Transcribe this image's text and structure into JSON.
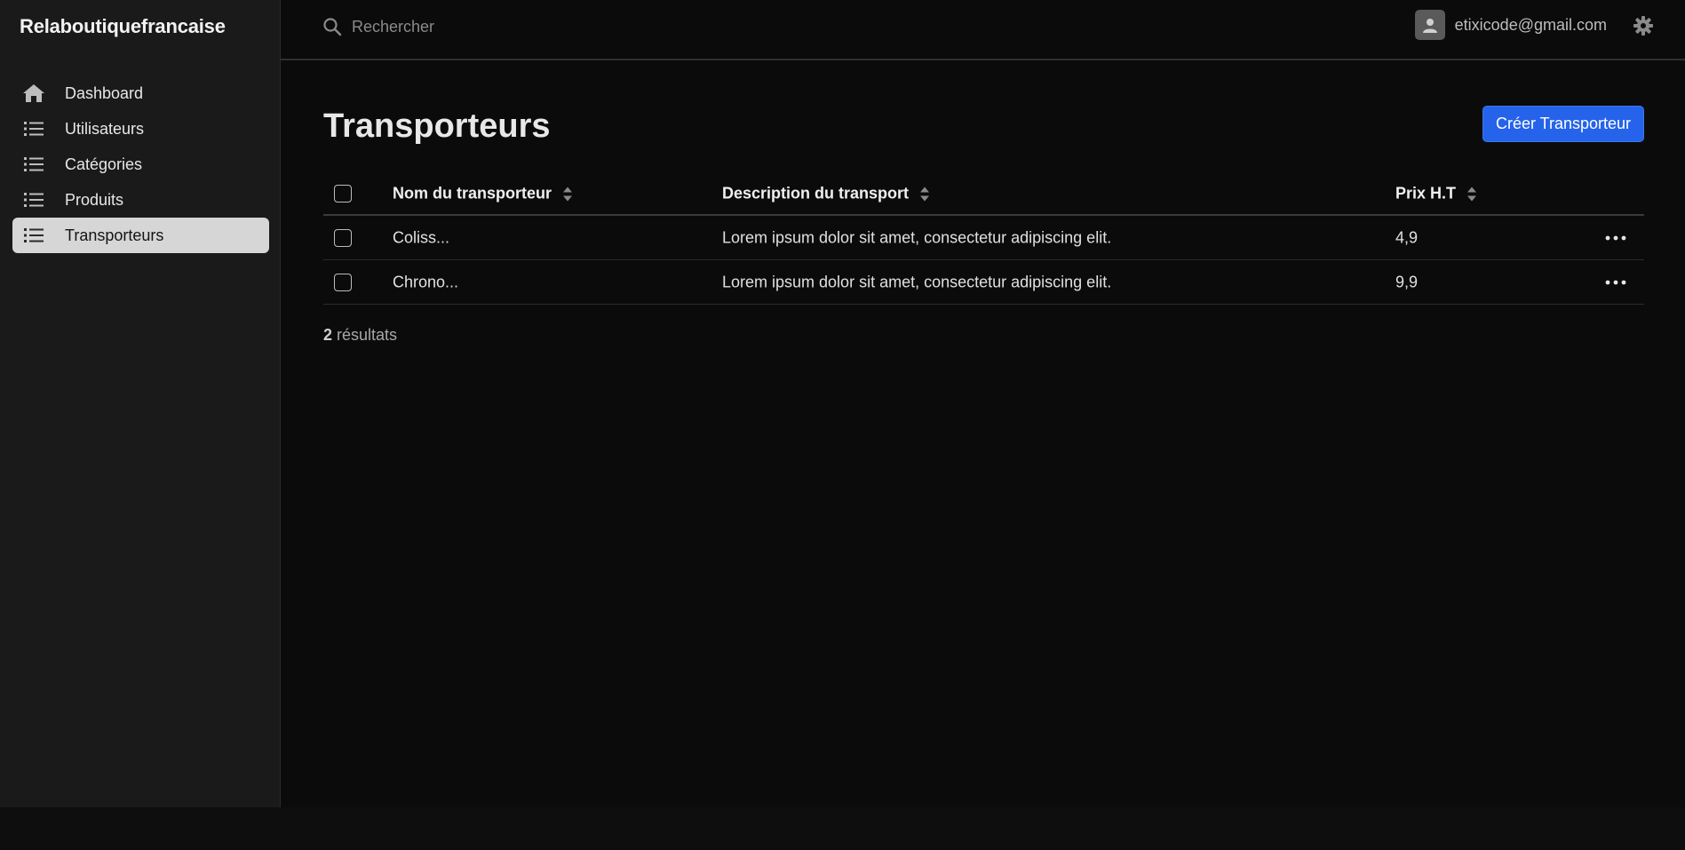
{
  "app": {
    "brand": "Relaboutiquefrancaise"
  },
  "sidebar": {
    "items": [
      {
        "label": "Dashboard",
        "icon": "home-icon",
        "active": false
      },
      {
        "label": "Utilisateurs",
        "icon": "list-icon",
        "active": false
      },
      {
        "label": "Catégories",
        "icon": "list-icon",
        "active": false
      },
      {
        "label": "Produits",
        "icon": "list-icon",
        "active": false
      },
      {
        "label": "Transporteurs",
        "icon": "list-icon",
        "active": true
      }
    ]
  },
  "topbar": {
    "search_placeholder": "Rechercher",
    "user_email": "etixicode@gmail.com"
  },
  "page": {
    "title": "Transporteurs",
    "create_button": "Créer Transporteur"
  },
  "table": {
    "columns": {
      "name": "Nom du transporteur",
      "description": "Description du transport",
      "price": "Prix H.T"
    },
    "rows": [
      {
        "name": "Coliss...",
        "description": "Lorem ipsum dolor sit amet, consectetur adipiscing elit.",
        "price": "4,9"
      },
      {
        "name": "Chrono...",
        "description": "Lorem ipsum dolor sit amet, consectetur adipiscing elit.",
        "price": "9,9"
      }
    ]
  },
  "results": {
    "count": "2",
    "label": "résultats"
  },
  "colors": {
    "accent": "#2563eb",
    "sidebar_bg": "#1a1a1a",
    "active_item_bg": "#d6d6d6",
    "main_bg": "#0b0b0b"
  }
}
